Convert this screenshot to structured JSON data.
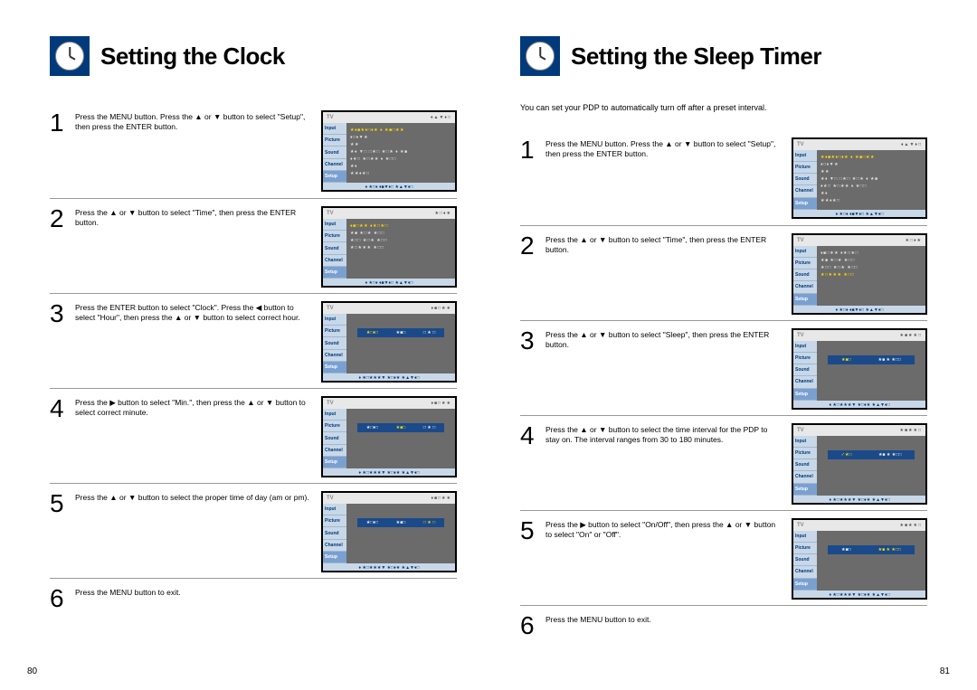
{
  "left": {
    "title": "Setting the Clock",
    "steps": [
      {
        "num": "1",
        "text": "Press the MENU button. Press the ▲ or ▼ button to select \"Setup\", then press the ENTER button."
      },
      {
        "num": "2",
        "text": "Press the ▲ or ▼ button to select \"Time\", then press the ENTER button."
      },
      {
        "num": "3",
        "text": "Press the ENTER button to select \"Clock\".\nPress the ◀ button to select \"Hour\", then press the ▲ or ▼ button to select correct hour."
      },
      {
        "num": "4",
        "text": "Press the ▶ button to select \"Min.\", then press the ▲ or ▼ button to select correct minute."
      },
      {
        "num": "5",
        "text": "Press the ▲ or ▼ button to select the proper time of day (am or pm)."
      },
      {
        "num": "6",
        "text": "Press the MENU button to exit."
      }
    ],
    "page_number": "80"
  },
  "right": {
    "title": "Setting the Sleep Timer",
    "intro": "You can set your PDP to automatically turn off after a preset interval.",
    "steps": [
      {
        "num": "1",
        "text": "Press the MENU button. Press the ▲ or ▼ button to select \"Setup\", then press the ENTER button."
      },
      {
        "num": "2",
        "text": "Press the ▲ or ▼ button to select \"Time\", then press the ENTER button."
      },
      {
        "num": "3",
        "text": "Press the ▲ or ▼ button to select \"Sleep\", then press the ENTER button."
      },
      {
        "num": "4",
        "text": "Press the ▲ or ▼ button to select the time interval for the PDP to stay on. The interval ranges from 30 to 180 minutes."
      },
      {
        "num": "5",
        "text": "Press the ▶ button to select \"On/Off\", then press the ▲ or ▼ button to select \"On\" or \"Off\"."
      },
      {
        "num": "6",
        "text": "Press the MENU button to exit."
      }
    ],
    "page_number": "81"
  },
  "tv": {
    "label": "TV",
    "tabs": [
      "Input",
      "Picture",
      "Sound",
      "Channel",
      "Setup"
    ],
    "topglyphs": "♦▲▼♦□",
    "bottomglyphs_a": "♦ ★□♦    ♦■▼♦□    ★▲▼♦□",
    "bottomglyphs_b": "♦ ★□★★★▼    ★□♦★    ★▲▼♦□",
    "content_setup": [
      "★♦■★♦□♦★  ♦ ★■□★★",
      "♦□♦▼★",
      "★★",
      "★♦ ▼□ □★□ ★□★  ♦ ★■",
      "♦★□ ★□★★   ♦ ★□□",
      "★♦",
      "★★♦★□"
    ],
    "content_time": [
      "♦■□★★  ♦★□★□",
      "★■ ★□★  ★□□",
      "★□□ ★□★  ★□□",
      "★□★★★   ★□□"
    ],
    "clock_hl": [
      "★□♦□",
      "★■□",
      "□ ★ □"
    ],
    "sleep_hl": [
      "★■□",
      "★■ ★ ★□□"
    ],
    "sleep_hl2": [
      "✓★□",
      "★■ ★ ★□□"
    ],
    "topglyphs_time": "★□♦★",
    "topglyphs_clock": "♦■□★★",
    "topglyphs_sleep": "★■★★□"
  }
}
